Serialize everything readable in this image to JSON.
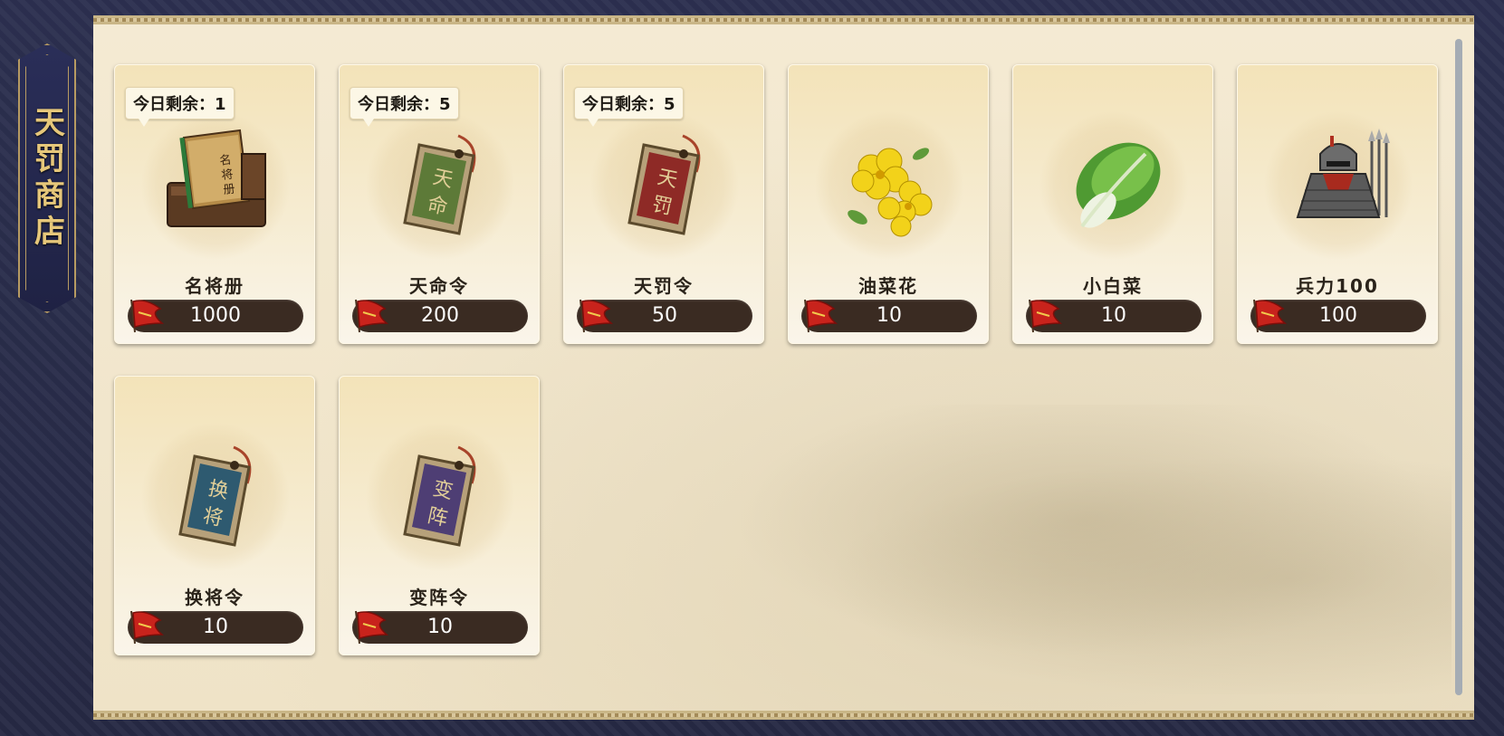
{
  "shop": {
    "title": "天罚商店"
  },
  "colors": {
    "panel_bg": "#f4ead3",
    "frame_bg": "#2c3050",
    "title_gold": "#e6c77a",
    "price_bar": "#3a2b22"
  },
  "currency_icon": "red-flag-icon",
  "items": [
    {
      "name": "名将册",
      "price": "1000",
      "limit": "今日剩余：1",
      "icon": "book-box-icon"
    },
    {
      "name": "天命令",
      "price": "200",
      "limit": "今日剩余：5",
      "icon": "green-token-icon"
    },
    {
      "name": "天罚令",
      "price": "50",
      "limit": "今日剩余：5",
      "icon": "red-token-icon"
    },
    {
      "name": "油菜花",
      "price": "10",
      "limit": "",
      "icon": "rapeseed-flower-icon"
    },
    {
      "name": "小白菜",
      "price": "10",
      "limit": "",
      "icon": "bok-choy-icon"
    },
    {
      "name": "兵力100",
      "price": "100",
      "limit": "",
      "icon": "soldier-armor-icon"
    },
    {
      "name": "换将令",
      "price": "10",
      "limit": "",
      "icon": "blue-token-icon"
    },
    {
      "name": "变阵令",
      "price": "10",
      "limit": "",
      "icon": "purple-token-icon"
    }
  ]
}
